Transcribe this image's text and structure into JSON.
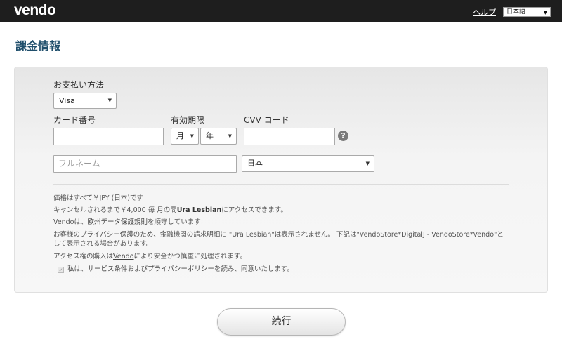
{
  "header": {
    "logo": "vendo",
    "help_label": "ヘルプ",
    "language_selected": "日本語",
    "background_color": "#1e1e1e"
  },
  "page": {
    "title": "課金情報",
    "title_color": "#1f4e6b"
  },
  "form": {
    "payment_method_label": "お支払い方法",
    "payment_method_value": "Visa",
    "card_number_label": "カード番号",
    "expiry_label": "有効期限",
    "expiry_month_value": "月",
    "expiry_year_value": "年",
    "cvv_label": "CVV コード",
    "cvv_help_icon": "question-circle-icon",
    "fullname_placeholder": "フルネーム",
    "country_value": "日本"
  },
  "notes": {
    "line1": "価格はすべて￥JPY (日本)です",
    "line2_pre": "キャンセルされるまで￥4,000 毎 月の間",
    "line2_bold": "Ura Lesbian",
    "line2_post": "にアクセスできます。",
    "line3_pre": "Vendoは、",
    "line3_link": "欧州データ保護規則",
    "line3_post": "を順守しています",
    "line4": "お客様のプライバシー保護のため、金融機関の請求明細に \"Ura Lesbian\"は表示されません。 下記は\"VendoStore*DigitalJ - VendoStore*Vendo\"と",
    "line5": "して表示される場合があります。",
    "line6_pre": "アクセス権の購入は",
    "line6_link": "Vendo",
    "line6_post": "により安全かつ慎重に処理されます。",
    "terms_pre": "私は、",
    "terms_link1": "サービス条件",
    "terms_mid": "および",
    "terms_link2": "プライバシーポリシー",
    "terms_post": "を読み、同意いたします。"
  },
  "actions": {
    "continue_label": "続行"
  }
}
